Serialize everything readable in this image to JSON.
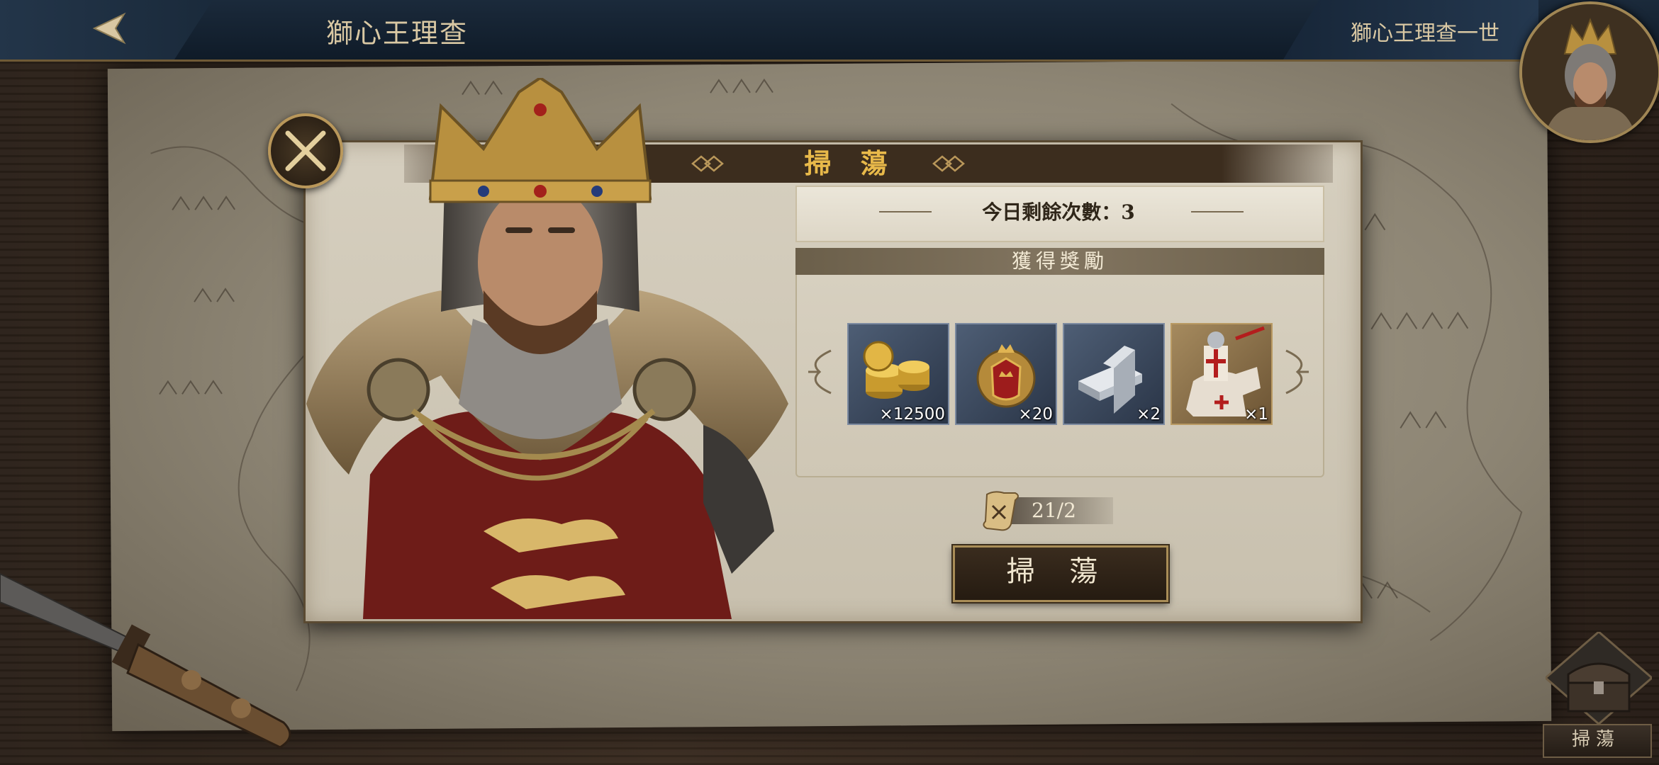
{
  "header": {
    "back_icon": "back-arrow-icon",
    "stage_title": "獅心王理查",
    "hero_name": "獅心王理查一世"
  },
  "dialog": {
    "title": "掃 蕩",
    "remaining_label": "今日剩餘次數：3",
    "rewards_title": "獲得獎勵",
    "rewards": [
      {
        "icon": "gold-coins-icon",
        "count": "×12500"
      },
      {
        "icon": "crown-emblem-medal-icon",
        "count": "×20"
      },
      {
        "icon": "silver-ingot-icon",
        "count": "×2"
      },
      {
        "icon": "knight-cavalry-card-icon",
        "count": "×1"
      }
    ],
    "sweep_scroll_count": "21/2",
    "sweep_button": "掃 蕩"
  },
  "chest": {
    "icon": "treasure-chest-icon",
    "label": "掃蕩"
  },
  "colors": {
    "title_gold": "#e8b94a",
    "header_dark": "#3c2d1e",
    "topbar_navy": "#0f1b28",
    "parchment": "#d6cfbf"
  }
}
